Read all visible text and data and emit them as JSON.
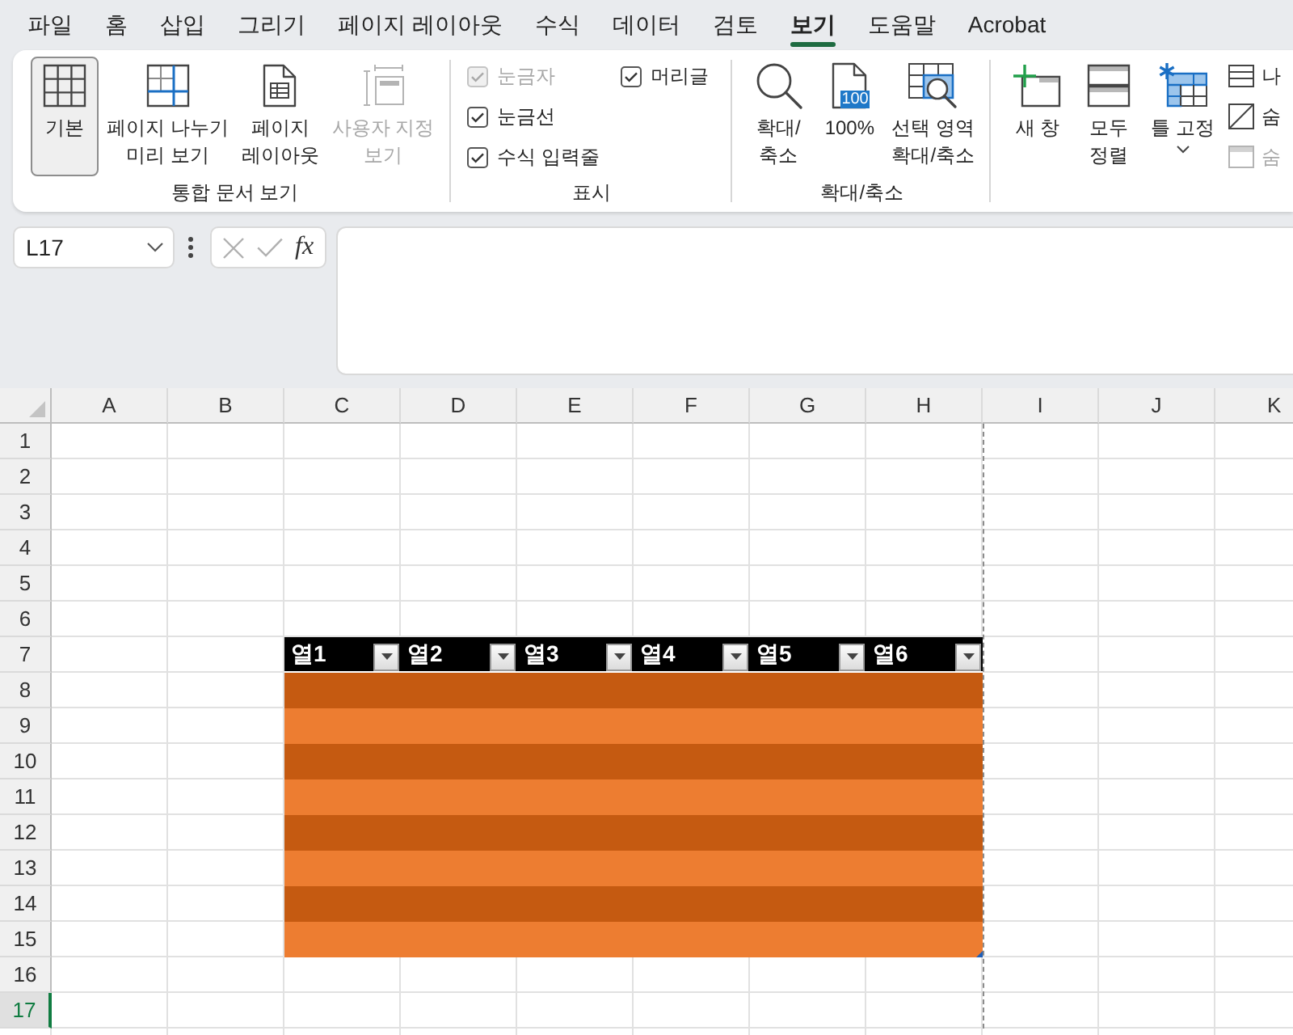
{
  "menu_tabs": [
    {
      "label": "파일",
      "selected": false
    },
    {
      "label": "홈",
      "selected": false
    },
    {
      "label": "삽입",
      "selected": false
    },
    {
      "label": "그리기",
      "selected": false
    },
    {
      "label": "페이지 레이아웃",
      "selected": false
    },
    {
      "label": "수식",
      "selected": false
    },
    {
      "label": "데이터",
      "selected": false
    },
    {
      "label": "검토",
      "selected": false
    },
    {
      "label": "보기",
      "selected": true
    },
    {
      "label": "도움말",
      "selected": false
    },
    {
      "label": "Acrobat",
      "selected": false
    }
  ],
  "ribbon_groups": [
    {
      "label": "통합 문서 보기",
      "items": [
        {
          "kind": "large",
          "label": "기본",
          "selected": true,
          "disabled": false
        },
        {
          "kind": "large",
          "label": "페이지 나누기\n미리 보기",
          "selected": false,
          "disabled": false
        },
        {
          "kind": "large",
          "label": "페이지\n레이아웃",
          "selected": false,
          "disabled": false
        },
        {
          "kind": "large",
          "label": "사용자 지정\n보기",
          "selected": false,
          "disabled": true
        }
      ]
    },
    {
      "label": "표시",
      "items": [
        {
          "kind": "checkbox",
          "label": "눈금자",
          "checked": true,
          "disabled": true
        },
        {
          "kind": "checkbox",
          "label": "눈금선",
          "checked": true,
          "disabled": false
        },
        {
          "kind": "checkbox",
          "label": "수식 입력줄",
          "checked": true,
          "disabled": false
        },
        {
          "kind": "checkbox",
          "label": "머리글",
          "checked": true,
          "disabled": false
        }
      ]
    },
    {
      "label": "확대/축소",
      "items": [
        {
          "kind": "large",
          "label": "확대/\n축소",
          "disabled": false
        },
        {
          "kind": "large",
          "label": "100%",
          "badge": "100",
          "disabled": false
        },
        {
          "kind": "large",
          "label": "선택 영역\n확대/축소",
          "disabled": false
        }
      ]
    },
    {
      "items": [
        {
          "kind": "large",
          "label": "새 창",
          "dropdown": false,
          "disabled": false
        },
        {
          "kind": "large",
          "label": "모두\n정렬",
          "dropdown": false,
          "disabled": false
        },
        {
          "kind": "large",
          "label": "틀 고정",
          "dropdown": true,
          "disabled": false
        },
        {
          "kind": "small",
          "label": "나",
          "disabled": false
        },
        {
          "kind": "small",
          "label": "숨",
          "disabled": false
        },
        {
          "kind": "small",
          "label": "숨",
          "disabled": true
        }
      ]
    }
  ],
  "formula_bar": {
    "name_box": "L17",
    "function_label": "fx"
  },
  "sheet": {
    "columns": [
      {
        "label": "A",
        "selected": false,
        "page_break": false
      },
      {
        "label": "B",
        "selected": false,
        "page_break": false
      },
      {
        "label": "C",
        "selected": false,
        "page_break": false
      },
      {
        "label": "D",
        "selected": false,
        "page_break": false
      },
      {
        "label": "E",
        "selected": false,
        "page_break": false
      },
      {
        "label": "F",
        "selected": false,
        "page_break": false
      },
      {
        "label": "G",
        "selected": false,
        "page_break": false
      },
      {
        "label": "H",
        "selected": false,
        "page_break": true
      },
      {
        "label": "I",
        "selected": false,
        "page_break": false
      },
      {
        "label": "J",
        "selected": false,
        "page_break": false
      },
      {
        "label": "K",
        "selected": false,
        "page_break": false
      }
    ],
    "rows": [
      {
        "label": "1",
        "selected": false
      },
      {
        "label": "2",
        "selected": false
      },
      {
        "label": "3",
        "selected": false
      },
      {
        "label": "4",
        "selected": false
      },
      {
        "label": "5",
        "selected": false
      },
      {
        "label": "6",
        "selected": false
      },
      {
        "label": "7",
        "selected": false
      },
      {
        "label": "8",
        "selected": false
      },
      {
        "label": "9",
        "selected": false
      },
      {
        "label": "10",
        "selected": false
      },
      {
        "label": "11",
        "selected": false
      },
      {
        "label": "12",
        "selected": false
      },
      {
        "label": "13",
        "selected": false
      },
      {
        "label": "14",
        "selected": false
      },
      {
        "label": "15",
        "selected": false
      },
      {
        "label": "16",
        "selected": false
      },
      {
        "label": "17",
        "selected": true
      }
    ],
    "table": {
      "headers": [
        "열1",
        "열2",
        "열3",
        "열4",
        "열5",
        "열6"
      ],
      "rows": [
        {
          "color": "#c55a11"
        },
        {
          "color": "#ed7d31"
        },
        {
          "color": "#c55a11"
        },
        {
          "color": "#ed7d31"
        },
        {
          "color": "#c55a11"
        },
        {
          "color": "#ed7d31"
        },
        {
          "color": "#c55a11"
        },
        {
          "color": "#ed7d31"
        }
      ]
    }
  }
}
